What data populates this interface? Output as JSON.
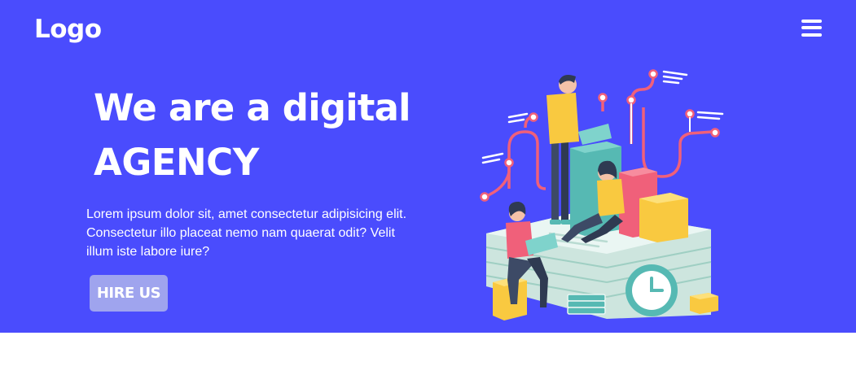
{
  "header": {
    "logo_text": "Logo",
    "menu_icon": "hamburger-menu-icon"
  },
  "hero": {
    "heading_line1": "We are a digital",
    "heading_line2": "AGENCY",
    "description": "Lorem ipsum dolor sit, amet consectetur adipisicing elit. Consectetur illo placeat nemo nam quaerat odit? Velit illum iste labore iure?",
    "cta_label": "HIRE US",
    "illustration": "digital-agency-team-illustration"
  },
  "colors": {
    "hero_background": "#4a4cfd",
    "button_background": "#9fa4ee",
    "page_background": "#ffffff",
    "text": "#ffffff"
  }
}
